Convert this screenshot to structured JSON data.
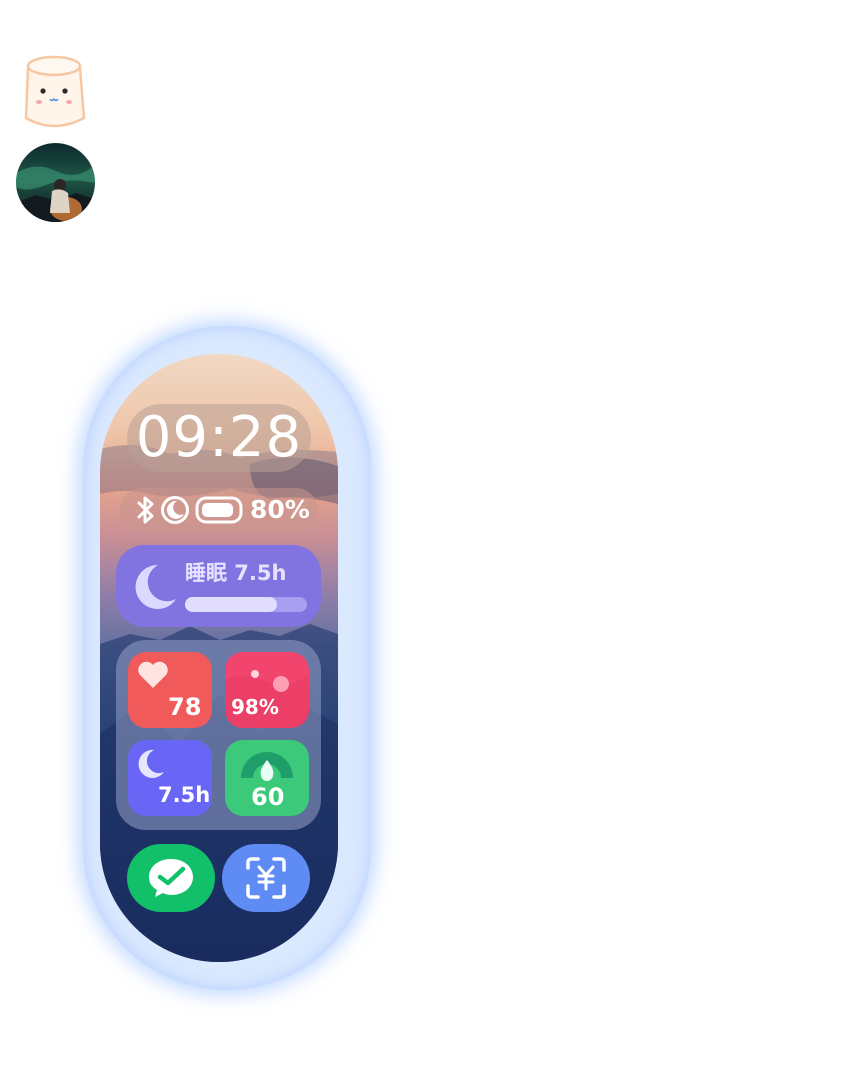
{
  "watch": {
    "time": "09:28",
    "status": {
      "battery_percent": "80%",
      "icons": [
        "bluetooth-icon",
        "do-not-disturb-icon",
        "battery-icon"
      ]
    },
    "sleep_card": {
      "title": "睡眠 7.5h",
      "progress": 0.75
    },
    "tiles": [
      {
        "name": "heart-rate",
        "icon": "heart-icon",
        "value": "78",
        "color": "#f05a5a"
      },
      {
        "name": "blood-oxygen",
        "icon": "blood-oxygen-icon",
        "value": "98%",
        "color": "#f2456d"
      },
      {
        "name": "sleep",
        "icon": "moon-icon",
        "value": "7.5h",
        "color": "#6a66f5"
      },
      {
        "name": "stress",
        "icon": "stress-gauge-icon",
        "value": "60",
        "color": "#3cc97a"
      }
    ],
    "apps": [
      {
        "name": "wechat",
        "icon": "wechat-icon",
        "color": "#12c06a"
      },
      {
        "name": "payment",
        "icon": "yuan-scan-icon",
        "color": "#5f8bf5"
      }
    ]
  },
  "avatars": [
    {
      "name": "mascot-avatar"
    },
    {
      "name": "aurora-photo-avatar"
    }
  ]
}
